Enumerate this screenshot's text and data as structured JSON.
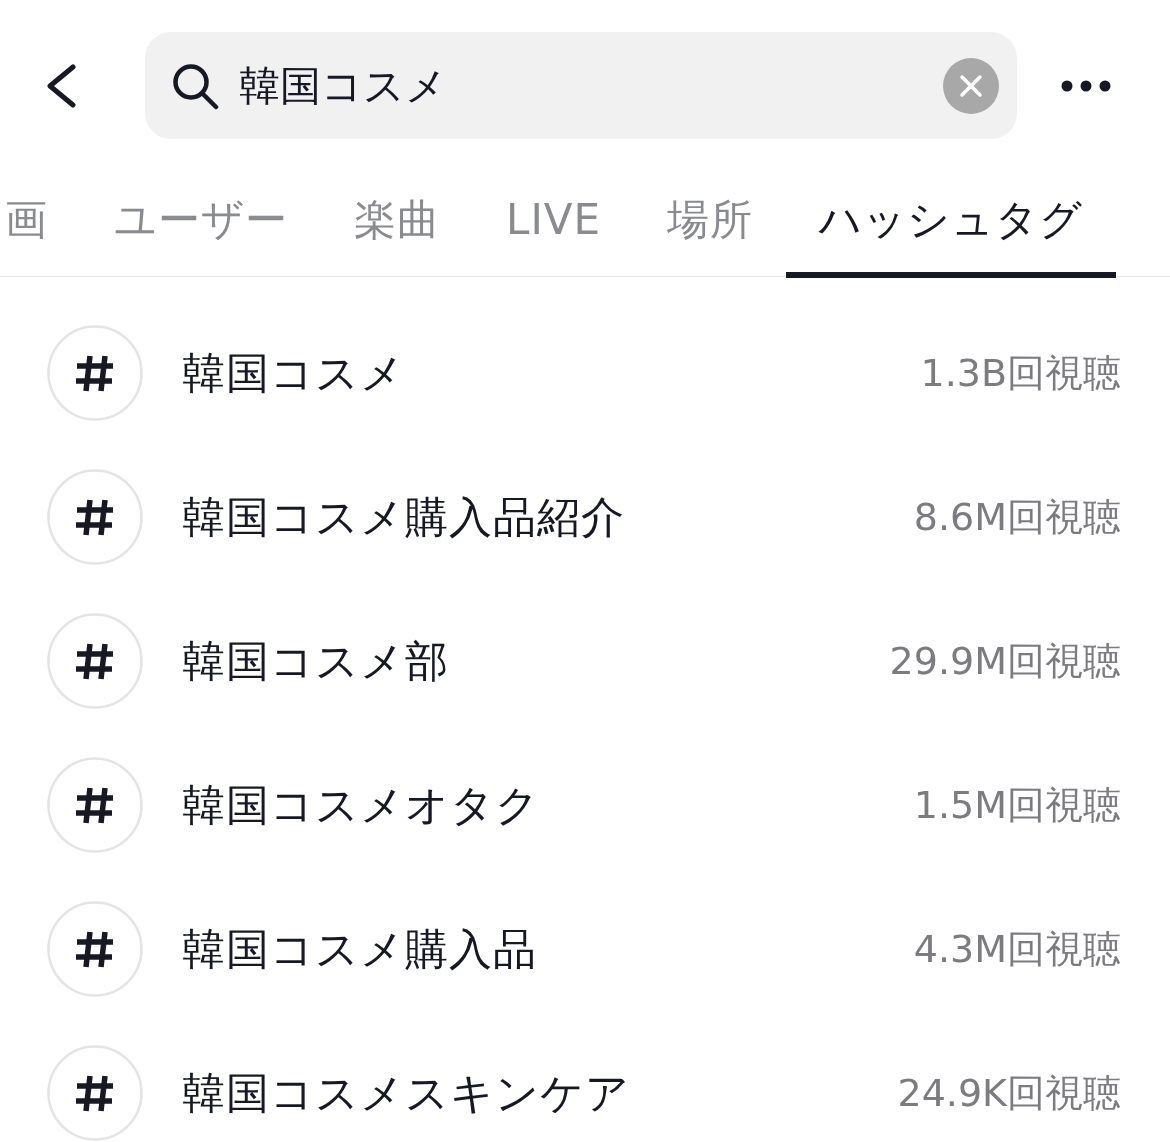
{
  "search": {
    "value": "韓国コスメ"
  },
  "tabs": [
    {
      "label": "画",
      "selected": false
    },
    {
      "label": "ユーザー",
      "selected": false
    },
    {
      "label": "楽曲",
      "selected": false
    },
    {
      "label": "LIVE",
      "selected": false
    },
    {
      "label": "場所",
      "selected": false
    },
    {
      "label": "ハッシュタグ",
      "selected": true
    }
  ],
  "hashtags": [
    {
      "name": "韓国コスメ",
      "views": "1.3B回視聴"
    },
    {
      "name": "韓国コスメ購入品紹介",
      "views": "8.6M回視聴"
    },
    {
      "name": "韓国コスメ部",
      "views": "29.9M回視聴"
    },
    {
      "name": "韓国コスメオタク",
      "views": "1.5M回視聴"
    },
    {
      "name": "韓国コスメ購入品",
      "views": "4.3M回視聴"
    },
    {
      "name": "韓国コスメスキンケア",
      "views": "24.9K回視聴"
    }
  ]
}
